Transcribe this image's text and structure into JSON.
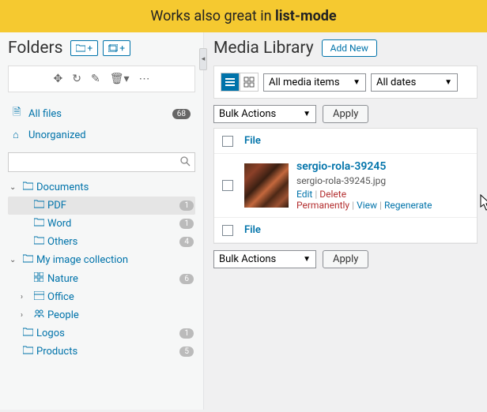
{
  "banner": {
    "prefix": "Works also great in ",
    "bold": "list-mode"
  },
  "sidebar": {
    "title": "Folders",
    "btn_new_folder": "+",
    "btn_new_gallery": "+",
    "pinned": {
      "all_label": "All files",
      "all_count": "68",
      "unorganized_label": "Unorganized"
    },
    "tree": [
      {
        "label": "Documents",
        "icon": "folder",
        "open": true,
        "indent": 0,
        "count": "",
        "bind": "t0"
      },
      {
        "label": "PDF",
        "icon": "folder",
        "indent": 1,
        "count": "1",
        "active": true,
        "bind": "t1"
      },
      {
        "label": "Word",
        "icon": "folder",
        "indent": 1,
        "count": "1",
        "bind": "t2"
      },
      {
        "label": "Others",
        "icon": "folder",
        "indent": 1,
        "count": "4",
        "bind": "t3"
      },
      {
        "label": "My image collection",
        "icon": "folder",
        "open": true,
        "indent": 0,
        "count": "",
        "bind": "t4"
      },
      {
        "label": "Nature",
        "icon": "grid",
        "indent": 1,
        "count": "6",
        "bind": "t5"
      },
      {
        "label": "Office",
        "icon": "card",
        "indent": 1,
        "chev": ">",
        "bind": "t6"
      },
      {
        "label": "People",
        "icon": "people",
        "indent": 1,
        "chev": ">",
        "bind": "t7"
      },
      {
        "label": "Logos",
        "icon": "folder",
        "indent": 0,
        "count": "1",
        "bind": "t8"
      },
      {
        "label": "Products",
        "icon": "folder",
        "indent": 0,
        "count": "5",
        "bind": "t9"
      }
    ]
  },
  "main": {
    "title": "Media Library",
    "add_new": "Add New",
    "filter_media": "All media items",
    "filter_dates": "All dates",
    "bulk_label": "Bulk Actions",
    "apply": "Apply",
    "col_file": "File",
    "file": {
      "title": "sergio-rola-39245",
      "filename": "sergio-rola-39245.jpg",
      "actions": {
        "edit": "Edit",
        "delete": "Delete Permanently",
        "view": "View",
        "regen": "Regenerate"
      }
    }
  }
}
